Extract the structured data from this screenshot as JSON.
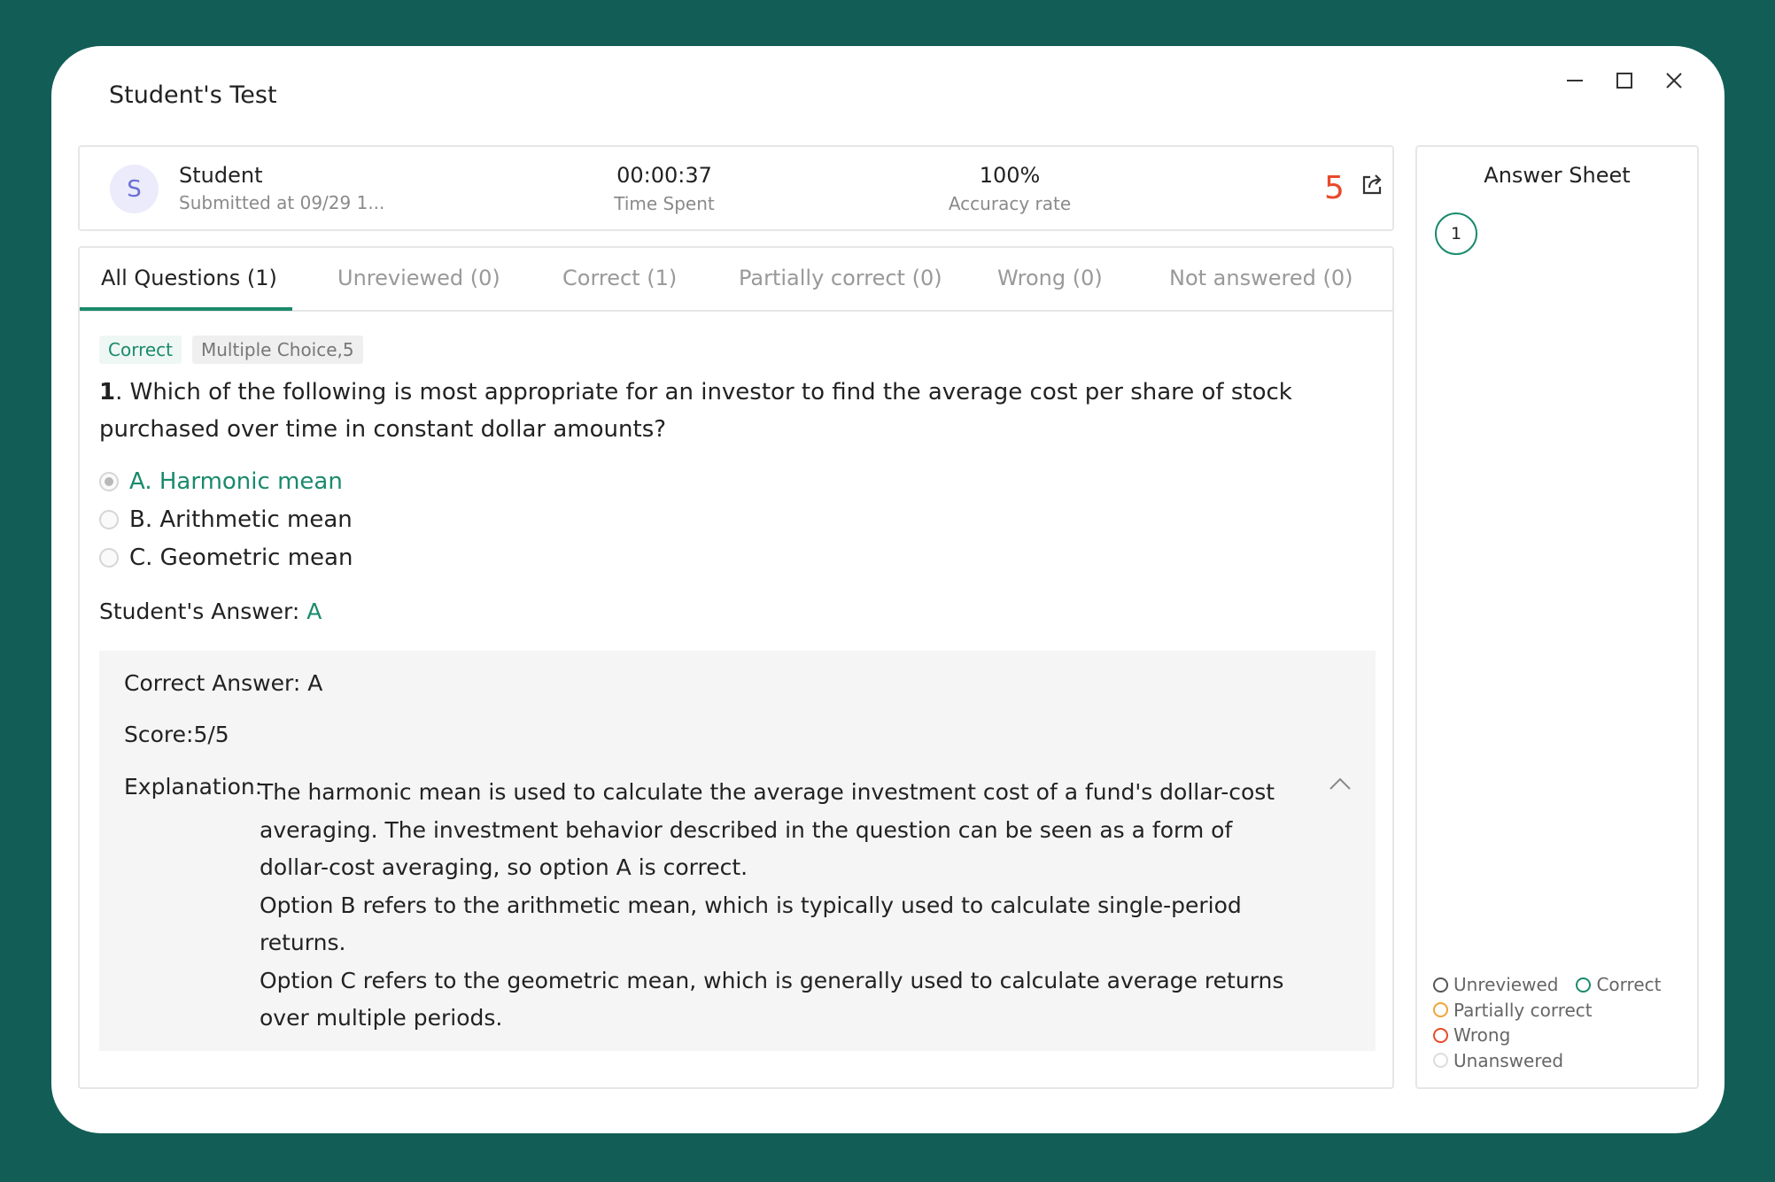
{
  "window": {
    "title": "Student's Test"
  },
  "summary": {
    "avatar_letter": "S",
    "student_name": "Student",
    "submitted": "Submitted at 09/29 1...",
    "time_value": "00:00:37",
    "time_label": "Time Spent",
    "accuracy_value": "100%",
    "accuracy_label": "Accuracy rate",
    "score": "5"
  },
  "tabs": [
    {
      "label": "All Questions (1)"
    },
    {
      "label": "Unreviewed (0)"
    },
    {
      "label": "Correct (1)"
    },
    {
      "label": "Partially correct (0)"
    },
    {
      "label": "Wrong (0)"
    },
    {
      "label": "Not answered (0)"
    }
  ],
  "question": {
    "status_badge": "Correct",
    "type_badge": "Multiple Choice,5",
    "number": "1",
    "text": ". Which of the following is most appropriate for an investor to find the average cost per share of stock purchased over time in constant dollar amounts?",
    "options": [
      {
        "label": "A. Harmonic mean"
      },
      {
        "label": "B. Arithmetic mean"
      },
      {
        "label": "C. Geometric mean"
      }
    ],
    "student_answer_label": "Student's Answer: ",
    "student_answer_value": "A"
  },
  "explanation": {
    "correct_answer": "Correct Answer:  A",
    "score": "Score:5/5",
    "label": "Explanation:",
    "paragraphs": [
      "The harmonic mean is used to calculate the average investment cost of a fund's dollar-cost averaging. The investment behavior described in the question can be seen as a form of dollar-cost averaging, so option A is correct.",
      "Option B refers to the arithmetic mean, which is typically used to calculate single-period returns.",
      "Option C refers to the geometric mean, which is generally used to calculate average returns over multiple periods."
    ]
  },
  "answer_sheet": {
    "title": "Answer Sheet",
    "bubble": "1",
    "legend": [
      {
        "label": "Unreviewed",
        "color": "#555555"
      },
      {
        "label": "Correct",
        "color": "#1a8a6c"
      },
      {
        "label": "Partially correct",
        "color": "#f0a43a"
      },
      {
        "label": "Wrong",
        "color": "#e84a2b"
      },
      {
        "label": "Unanswered",
        "color": "#dddddd"
      }
    ]
  },
  "colors": {
    "background": "#125e56",
    "accent": "#1a8a6c",
    "score": "#e84a2b"
  }
}
